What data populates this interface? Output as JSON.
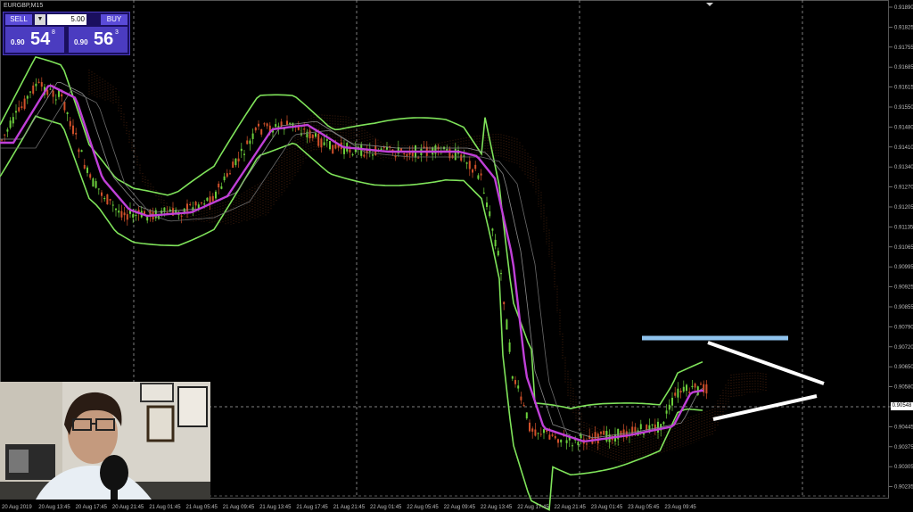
{
  "symbol": "EURGBP,M15",
  "trade_panel": {
    "sell_label": "SELL",
    "buy_label": "BUY",
    "lot_value": "5.00",
    "sell_prefix": "0.90",
    "sell_big": "54",
    "sell_sup": "8",
    "buy_prefix": "0.90",
    "buy_big": "56",
    "buy_sup": "3"
  },
  "current_price_tag": "0.90548",
  "y_axis_labels": [
    "0.91890",
    "0.91825",
    "0.91755",
    "0.91685",
    "0.91615",
    "0.91550",
    "0.91480",
    "0.91410",
    "0.91340",
    "0.91270",
    "0.91205",
    "0.91135",
    "0.91065",
    "0.90995",
    "0.90925",
    "0.90855",
    "0.90790",
    "0.90720",
    "0.90650",
    "0.90580",
    "0.90515",
    "0.90445",
    "0.90375",
    "0.90305",
    "0.90235"
  ],
  "x_axis_labels": [
    "20 Aug 2019",
    "20 Aug 13:45",
    "20 Aug 17:45",
    "20 Aug 21:45",
    "21 Aug 01:45",
    "21 Aug 05:45",
    "21 Aug 09:45",
    "21 Aug 13:45",
    "21 Aug 17:45",
    "21 Aug 21:45",
    "22 Aug 01:45",
    "22 Aug 05:45",
    "22 Aug 09:45",
    "22 Aug 13:45",
    "22 Aug 17:45",
    "22 Aug 21:45",
    "23 Aug 01:45",
    "23 Aug 05:45",
    "23 Aug 09:45"
  ],
  "colors": {
    "background": "#000000",
    "bollinger": "#7fe35a",
    "moving_average": "#c040d8",
    "candle_up": "#6ccf3c",
    "candle_down": "#d0502a",
    "ichimoku_cloud": "#8a3f1a",
    "resistance_line": "#8fc3ee",
    "triangle_lines": "#ffffff"
  },
  "webcam": {
    "description_icon": "presenter-video-icon"
  }
}
